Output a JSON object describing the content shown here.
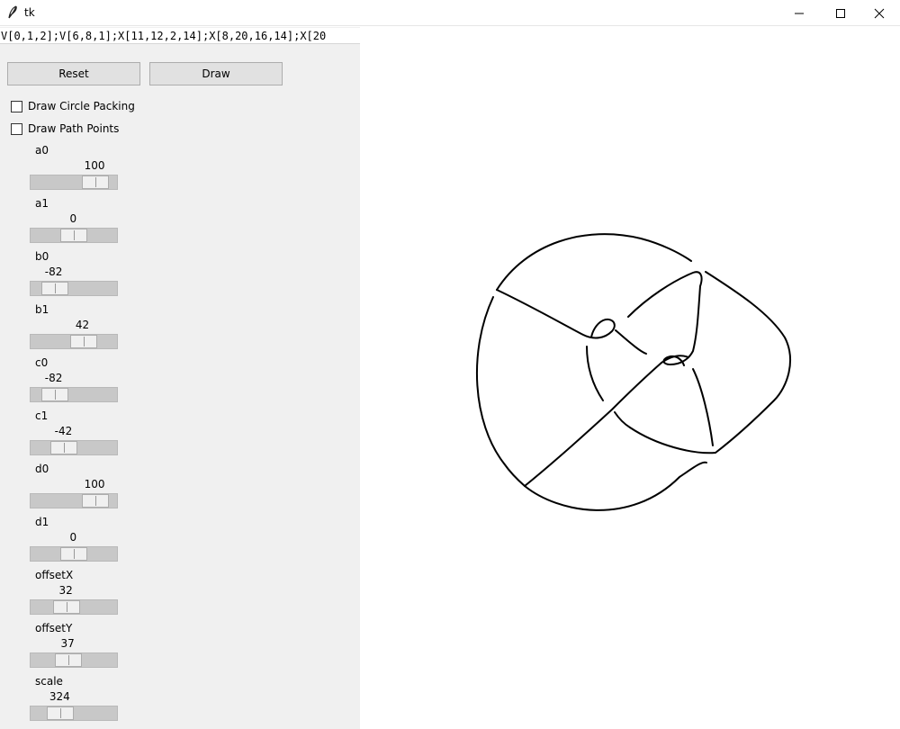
{
  "window": {
    "title": "tk"
  },
  "code_entry": {
    "value": "V[0,1,2];V[6,8,1];X[11,12,2,14];X[8,20,16,14];X[20"
  },
  "buttons": {
    "reset": "Reset",
    "draw": "Draw"
  },
  "checkboxes": [
    {
      "label": "Draw Circle Packing",
      "checked": false
    },
    {
      "label": "Draw Path Points",
      "checked": false
    }
  ],
  "sliders": [
    {
      "label": "a0",
      "value": "100",
      "fraction": 0.84
    },
    {
      "label": "a1",
      "value": "0",
      "fraction": 0.49
    },
    {
      "label": "b0",
      "value": "-82",
      "fraction": 0.17
    },
    {
      "label": "b1",
      "value": "42",
      "fraction": 0.64
    },
    {
      "label": "c0",
      "value": "-82",
      "fraction": 0.17
    },
    {
      "label": "c1",
      "value": "-42",
      "fraction": 0.33
    },
    {
      "label": "d0",
      "value": "100",
      "fraction": 0.84
    },
    {
      "label": "d1",
      "value": "0",
      "fraction": 0.49
    },
    {
      "label": "offsetX",
      "value": "32",
      "fraction": 0.37
    },
    {
      "label": "offsetY",
      "value": "37",
      "fraction": 0.4
    },
    {
      "label": "scale",
      "value": "324",
      "fraction": 0.27
    }
  ]
}
